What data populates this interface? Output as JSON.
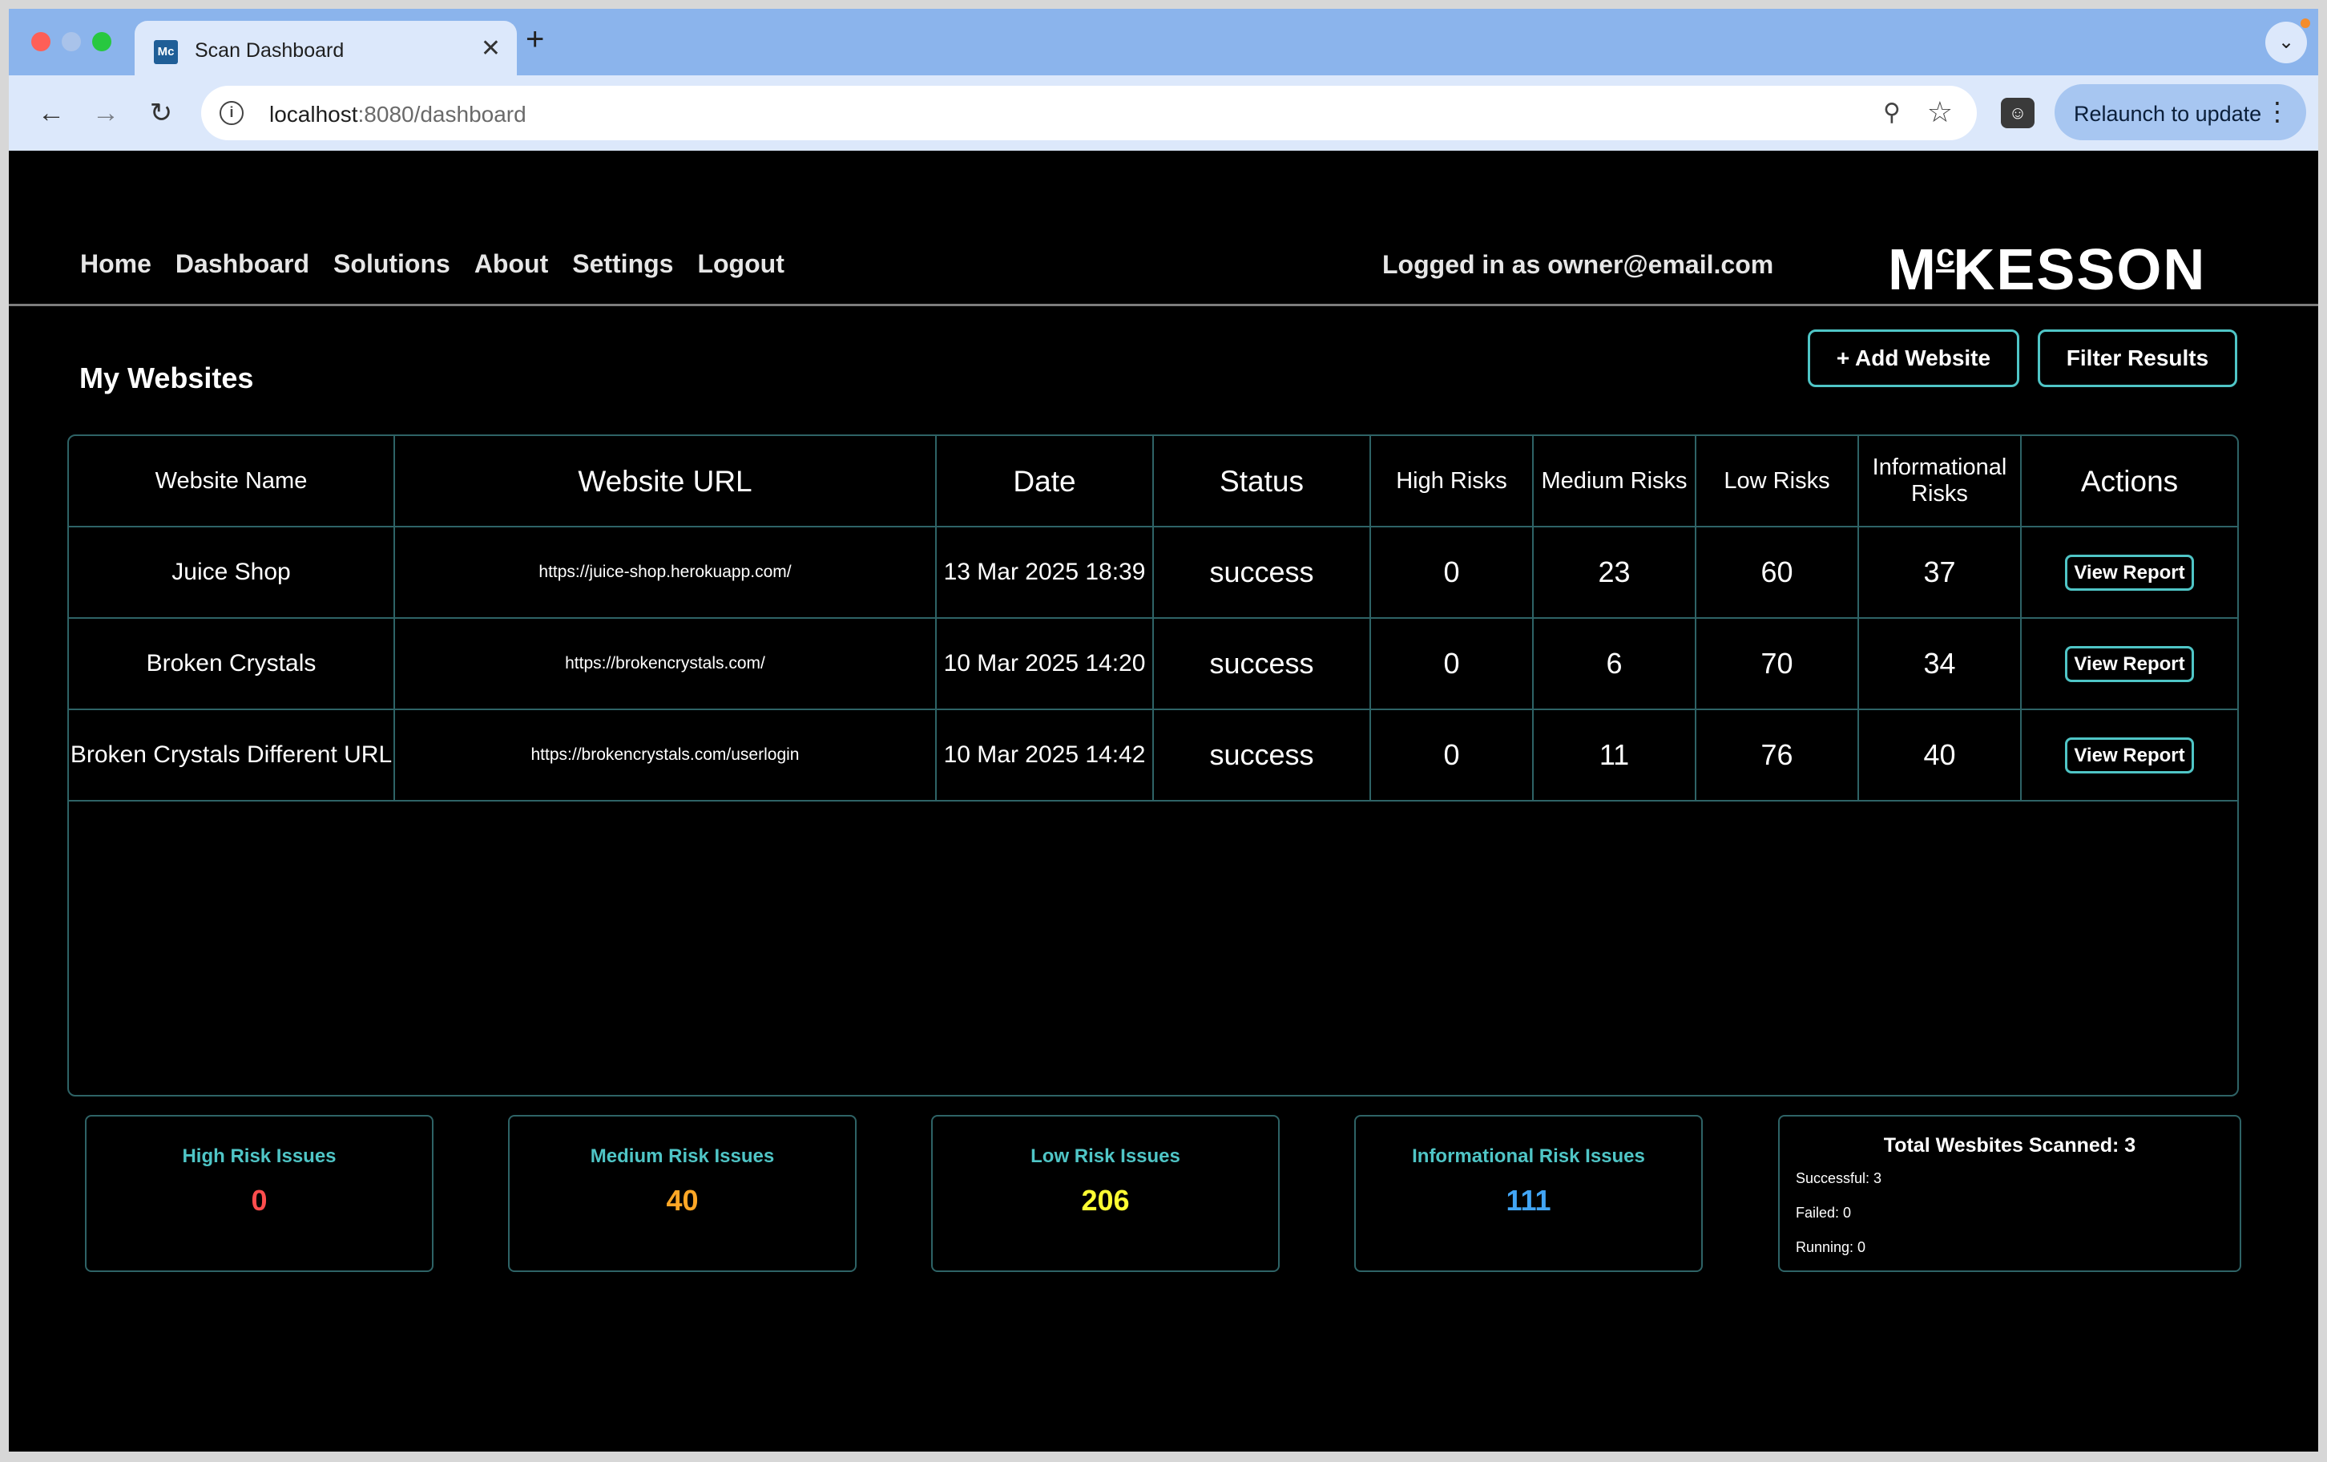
{
  "browser": {
    "tab_title": "Scan Dashboard",
    "tab_favicon_text": "Mc",
    "url_host": "localhost",
    "url_path": ":8080/dashboard",
    "relaunch_label": "Relaunch to update"
  },
  "nav": {
    "home": "Home",
    "dashboard": "Dashboard",
    "solutions": "Solutions",
    "about": "About",
    "settings": "Settings",
    "logout": "Logout"
  },
  "user": {
    "logged_in_text": "Logged in as owner@email.com"
  },
  "brand": {
    "pre": "M",
    "sup": "c",
    "post": "KESSON"
  },
  "page": {
    "title": "My Websites",
    "add_website_label": "+ Add Website",
    "filter_results_label": "Filter Results"
  },
  "table": {
    "headers": {
      "name": "Website Name",
      "url": "Website URL",
      "date": "Date",
      "status": "Status",
      "high": "High Risks",
      "medium": "Medium Risks",
      "low": "Low Risks",
      "info": "Informational Risks",
      "actions": "Actions"
    },
    "rows": [
      {
        "name": "Juice Shop",
        "url": "https://juice-shop.herokuapp.com/",
        "date": "13 Mar 2025 18:39",
        "status": "success",
        "high": "0",
        "medium": "23",
        "low": "60",
        "info": "37",
        "action": "View Report"
      },
      {
        "name": "Broken Crystals",
        "url": "https://brokencrystals.com/",
        "date": "10 Mar 2025 14:20",
        "status": "success",
        "high": "0",
        "medium": "6",
        "low": "70",
        "info": "34",
        "action": "View Report"
      },
      {
        "name": "Broken Crystals Different URL",
        "url": "https://brokencrystals.com/userlogin",
        "date": "10 Mar 2025 14:42",
        "status": "success",
        "high": "0",
        "medium": "11",
        "low": "76",
        "info": "40",
        "action": "View Report"
      }
    ]
  },
  "summary": {
    "high": {
      "label": "High Risk Issues",
      "value": "0",
      "color": "#ff4d4d"
    },
    "medium": {
      "label": "Medium Risk Issues",
      "value": "40",
      "color": "#ffa726"
    },
    "low": {
      "label": "Low Risk Issues",
      "value": "206",
      "color": "#ffff33"
    },
    "info": {
      "label": "Informational Risk Issues",
      "value": "111",
      "color": "#42a5f5"
    },
    "total": {
      "title": "Total Wesbites Scanned: 3",
      "successful": "Successful: 3",
      "failed": "Failed: 0",
      "running": "Running: 0"
    }
  },
  "colors": {
    "accent": "#4fc5c6",
    "border": "#2e6366",
    "background": "#000000"
  }
}
